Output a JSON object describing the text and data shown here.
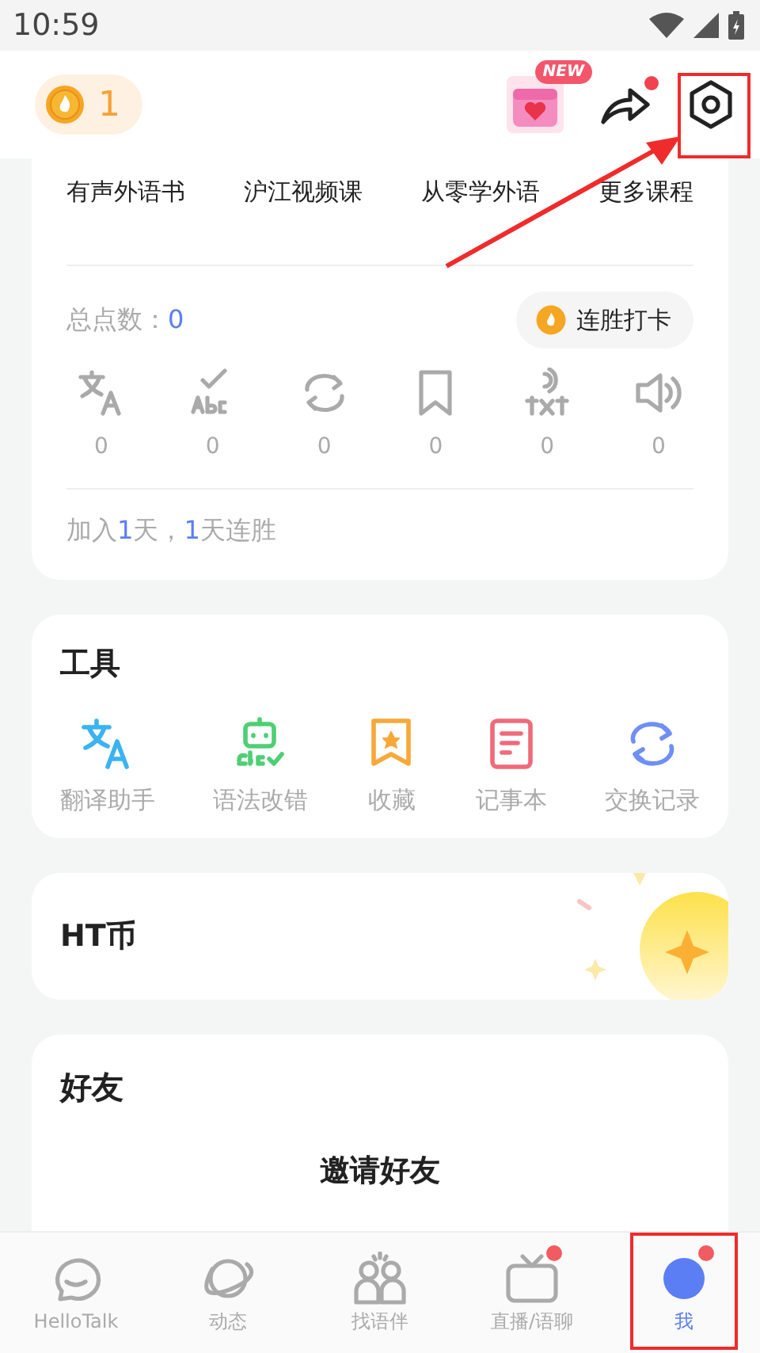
{
  "status_bar": {
    "time": "10:59"
  },
  "header": {
    "streak_count": "1",
    "gift_badge": "NEW",
    "share_notification": true
  },
  "courses": [
    "有声外语书",
    "沪江视频课",
    "从零学外语",
    "更多课程"
  ],
  "stats": {
    "label": "总点数：",
    "value": "0",
    "checkin_button": "连胜打卡",
    "counters": [
      {
        "kind": "translate",
        "value": "0"
      },
      {
        "kind": "grammar",
        "value": "0"
      },
      {
        "kind": "exchange",
        "value": "0"
      },
      {
        "kind": "bookmark",
        "value": "0"
      },
      {
        "kind": "voice-text",
        "value": "0"
      },
      {
        "kind": "speaker",
        "value": "0"
      }
    ],
    "join_text": [
      {
        "text": "加入",
        "highlight": false
      },
      {
        "text": "1",
        "highlight": true
      },
      {
        "text": "天，",
        "highlight": false
      },
      {
        "text": "1",
        "highlight": true
      },
      {
        "text": "天连胜",
        "highlight": false
      }
    ]
  },
  "tools": {
    "title": "工具",
    "items": [
      {
        "kind": "translate",
        "label": "翻译助手",
        "color": "#3bb3f0"
      },
      {
        "kind": "grammar",
        "label": "语法改错",
        "color": "#4fcf74"
      },
      {
        "kind": "bookmark",
        "label": "收藏",
        "color": "#f7a838"
      },
      {
        "kind": "notebook",
        "label": "记事本",
        "color": "#f06a7a"
      },
      {
        "kind": "exchange",
        "label": "交换记录",
        "color": "#6f8ff5"
      }
    ]
  },
  "ht_coin": {
    "title": "HT币"
  },
  "friends": {
    "title": "好友",
    "invite": "邀请好友"
  },
  "nav": [
    {
      "kind": "chat",
      "label": "HelloTalk",
      "selected": false,
      "badge": false
    },
    {
      "kind": "planet",
      "label": "动态",
      "selected": false,
      "badge": false
    },
    {
      "kind": "people",
      "label": "找语伴",
      "selected": false,
      "badge": false
    },
    {
      "kind": "tv",
      "label": "直播/语聊",
      "selected": false,
      "badge": true
    },
    {
      "kind": "me",
      "label": "我",
      "selected": true,
      "badge": true
    }
  ]
}
